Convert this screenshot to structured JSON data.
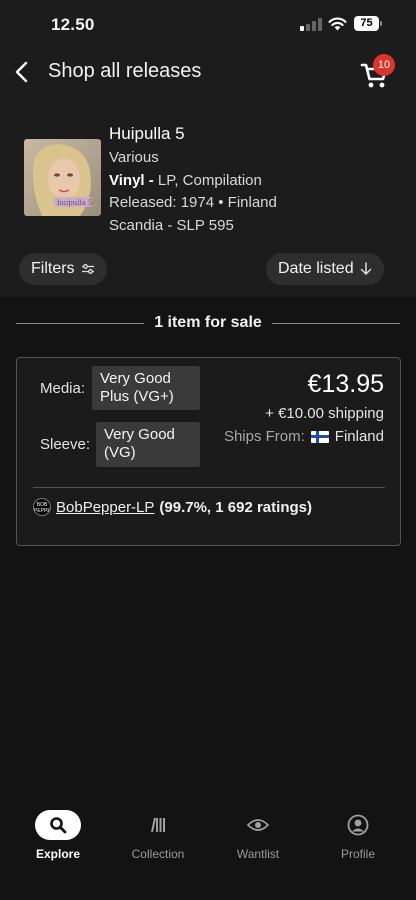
{
  "status_bar": {
    "time": "12.50",
    "battery": "75"
  },
  "nav": {
    "title": "Shop all releases",
    "cart_count": "10"
  },
  "release": {
    "title": "Huipulla 5",
    "artist": "Various",
    "format_label": "Vinyl -",
    "format_detail": " LP, Compilation",
    "released": "Released: 1974 • Finland",
    "label": "Scandia - SLP 595",
    "cover_text": "huipulla 5"
  },
  "filters": {
    "filters_label": "Filters",
    "sort_label": "Date listed"
  },
  "listings_heading": "1 item for sale",
  "listing": {
    "media_label": "Media:",
    "media_condition": "Very Good Plus (VG+)",
    "sleeve_label": "Sleeve:",
    "sleeve_condition": "Very Good (VG)",
    "price": "€13.95",
    "shipping": "+ €10.00 shipping",
    "ships_from_label": "Ships From:",
    "ships_from_country": "Finland",
    "seller_avatar_text": "BOB PEPPER",
    "seller_name": "BobPepper-LP",
    "seller_rating": "(99.7%, 1 692 ratings)"
  },
  "tabs": [
    {
      "label": "Explore",
      "icon": "search-icon",
      "active": true
    },
    {
      "label": "Collection",
      "icon": "collection-icon",
      "active": false
    },
    {
      "label": "Wantlist",
      "icon": "eye-icon",
      "active": false
    },
    {
      "label": "Profile",
      "icon": "profile-icon",
      "active": false
    }
  ],
  "colors": {
    "badge": "#d9352b",
    "background": "#131313",
    "header_bg": "#1c1c1c"
  }
}
